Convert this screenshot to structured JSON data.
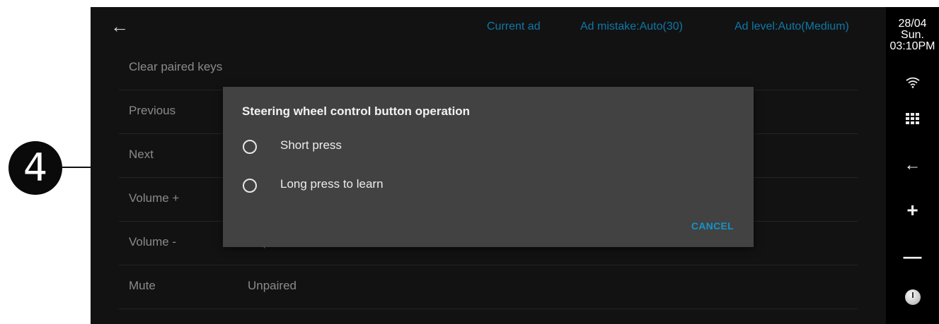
{
  "callout": {
    "number": "4"
  },
  "topbar": {
    "links": [
      "Current ad",
      "Ad mistake:Auto(30)",
      "Ad level:Auto(Medium)"
    ]
  },
  "list": {
    "rows": [
      {
        "label": "Clear paired keys",
        "value": ""
      },
      {
        "label": "Previous",
        "value": ""
      },
      {
        "label": "Next",
        "value": ""
      },
      {
        "label": "Volume +",
        "value": ""
      },
      {
        "label": "Volume -",
        "value": "Unpaired"
      },
      {
        "label": "Mute",
        "value": "Unpaired"
      }
    ]
  },
  "dialog": {
    "title": "Steering wheel control button operation",
    "options": [
      "Short press",
      "Long press to learn"
    ],
    "cancel_label": "CANCEL"
  },
  "sidebar": {
    "date": "28/04",
    "day": "Sun.",
    "time": "03:10PM",
    "icons": [
      "wifi-icon",
      "apps-grid-icon",
      "back-icon",
      "volume-up-icon",
      "volume-down-icon",
      "power-icon"
    ]
  },
  "colors": {
    "accent": "#0f78a8",
    "dialog_bg": "#424242",
    "screen_bg": "#121212"
  }
}
